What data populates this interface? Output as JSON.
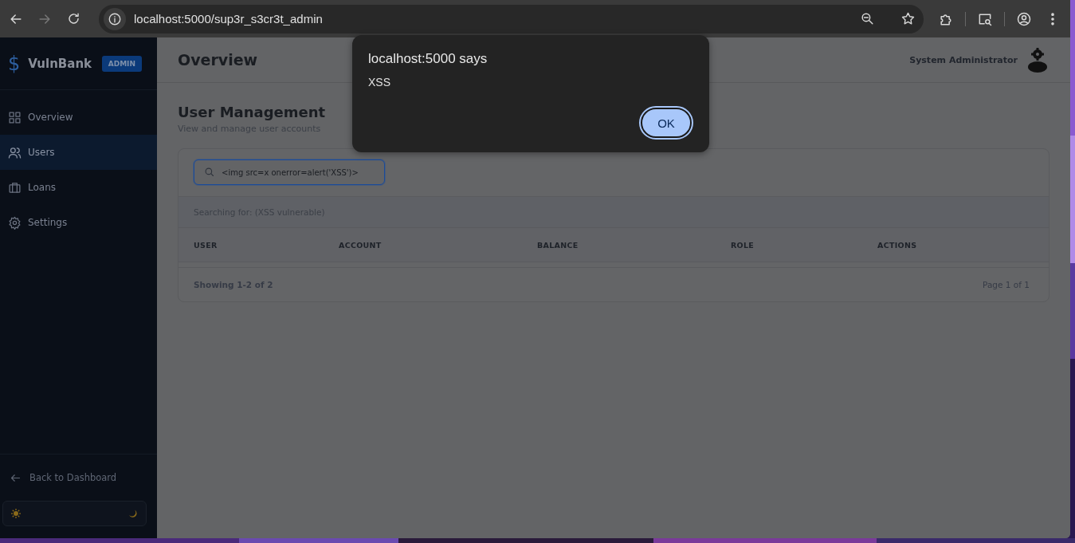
{
  "browser": {
    "url": "localhost:5000/sup3r_s3cr3t_admin"
  },
  "sidebar": {
    "logo": "$",
    "brand": "VulnBank",
    "badge": "ADMIN",
    "items": [
      {
        "label": "Overview",
        "selected": false
      },
      {
        "label": "Users",
        "selected": true
      },
      {
        "label": "Loans",
        "selected": false
      },
      {
        "label": "Settings",
        "selected": false
      }
    ],
    "back_link": "Back to Dashboard"
  },
  "header": {
    "title": "Overview",
    "user": "System Administrator"
  },
  "content": {
    "title": "User Management",
    "subtitle": "View and manage user accounts",
    "search": {
      "value": "<img src=x onerror=alert('XSS')>",
      "focused": true
    },
    "search_note": "Searching for:  (XSS vulnerable)",
    "table": {
      "columns": [
        "USER",
        "ACCOUNT",
        "BALANCE",
        "ROLE",
        "ACTIONS"
      ]
    },
    "footer": {
      "showing": "Showing 1-2 of 2",
      "page": "Page 1 of 1"
    }
  },
  "dialog": {
    "title": "localhost:5000 says",
    "message": "XSS",
    "button": "OK"
  }
}
